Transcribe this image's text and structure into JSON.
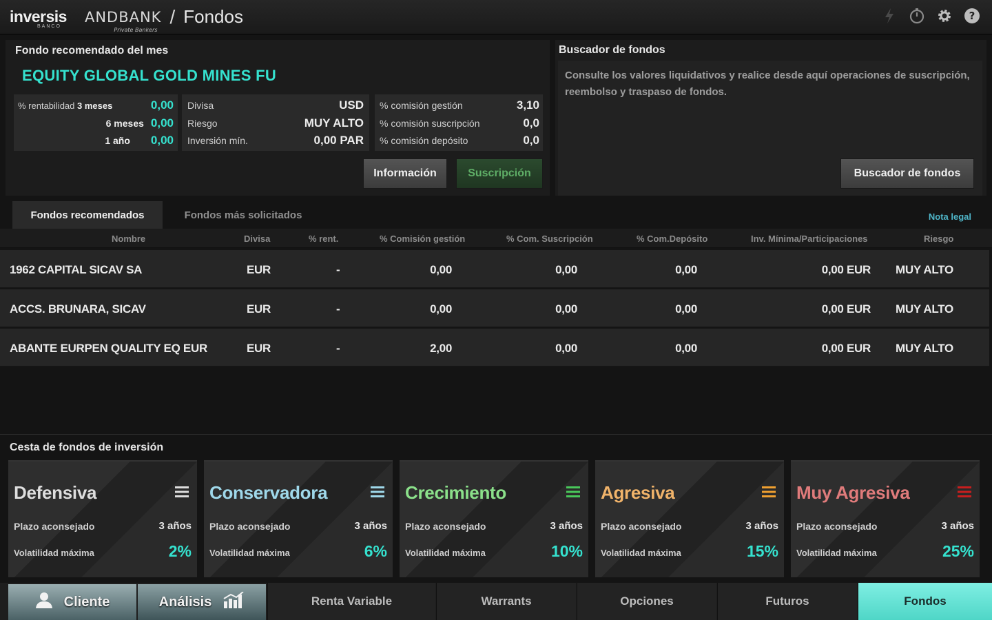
{
  "header": {
    "logo": "inversis",
    "logo_sub": "BANCO",
    "brand": "ANDBANK",
    "brand_sub": "Private Bankers",
    "separator": "/",
    "title": "Fondos",
    "icons": [
      "lightning-icon",
      "timer-icon",
      "gear-icon",
      "help-icon"
    ]
  },
  "recommended": {
    "title": "Fondo recomendado del mes",
    "fund_name": "EQUITY GLOBAL GOLD MINES FU",
    "rent_label": "% rentabilidad",
    "periods": [
      {
        "label": "3 meses",
        "value": "0,00"
      },
      {
        "label": "6 meses",
        "value": "0,00"
      },
      {
        "label": "1 año",
        "value": "0,00"
      }
    ],
    "details": [
      {
        "label": "Divisa",
        "value": "USD"
      },
      {
        "label": "Riesgo",
        "value": "MUY ALTO"
      },
      {
        "label": "Inversión mín.",
        "value": "0,00 PAR"
      }
    ],
    "commissions": [
      {
        "label": "% comisión gestión",
        "value": "3,10"
      },
      {
        "label": "% comisión suscripción",
        "value": "0,0"
      },
      {
        "label": "% comisión depósito",
        "value": "0,0"
      }
    ],
    "info_button": "Información",
    "subscribe_button": "Suscripción"
  },
  "buscador": {
    "title": "Buscador de fondos",
    "description": "Consulte los valores liquidativos y realice desde aquí operaciones de suscripción, reembolso y traspaso de fondos.",
    "button": "Buscador de fondos"
  },
  "tabs": [
    {
      "label": "Fondos recomendados",
      "active": true
    },
    {
      "label": "Fondos más solicitados",
      "active": false
    }
  ],
  "nota_legal": "Nota legal",
  "table": {
    "columns": [
      "Nombre",
      "Divisa",
      "% rent.",
      "% Comisión gestión",
      "% Com. Suscripción",
      "% Com.Depósito",
      "Inv. Mínima/Participaciones",
      "Riesgo"
    ],
    "rows": [
      [
        "1962 CAPITAL SICAV SA",
        "EUR",
        "-",
        "0,00",
        "0,00",
        "0,00",
        "0,00 EUR",
        "MUY ALTO"
      ],
      [
        "ACCS. BRUNARA, SICAV",
        "EUR",
        "-",
        "0,00",
        "0,00",
        "0,00",
        "0,00 EUR",
        "MUY ALTO"
      ],
      [
        "ABANTE EURPEN QUALITY EQ EUR",
        "EUR",
        "-",
        "2,00",
        "0,00",
        "0,00",
        "0,00 EUR",
        "MUY ALTO"
      ]
    ]
  },
  "cesta": {
    "title": "Cesta de fondos de inversión",
    "plazo_label": "Plazo aconsejado",
    "vol_label": "Volatilidad máxima",
    "cards": [
      {
        "name": "Defensiva",
        "plazo": "3 años",
        "vol": "2%",
        "color": "#dedede",
        "icon_color": "#dedede"
      },
      {
        "name": "Conservadora",
        "plazo": "3 años",
        "vol": "6%",
        "color": "#9fd8ea",
        "icon_color": "#9fd8ea"
      },
      {
        "name": "Crecimiento",
        "plazo": "3 años",
        "vol": "10%",
        "color": "#8be08a",
        "icon_color": "#49c85a"
      },
      {
        "name": "Agresiva",
        "plazo": "3 años",
        "vol": "15%",
        "color": "#f0b36a",
        "icon_color": "#f0a030"
      },
      {
        "name": "Muy Agresiva",
        "plazo": "3 años",
        "vol": "25%",
        "color": "#e07b7b",
        "icon_color": "#c81e1e"
      }
    ],
    "vol_color": "#35e2cf"
  },
  "bottom_nav": {
    "cliente": "Cliente",
    "analisis": "Análisis",
    "items": [
      "Renta Variable",
      "Warrants",
      "Opciones",
      "Futuros",
      "Fondos"
    ],
    "active": "Fondos"
  }
}
